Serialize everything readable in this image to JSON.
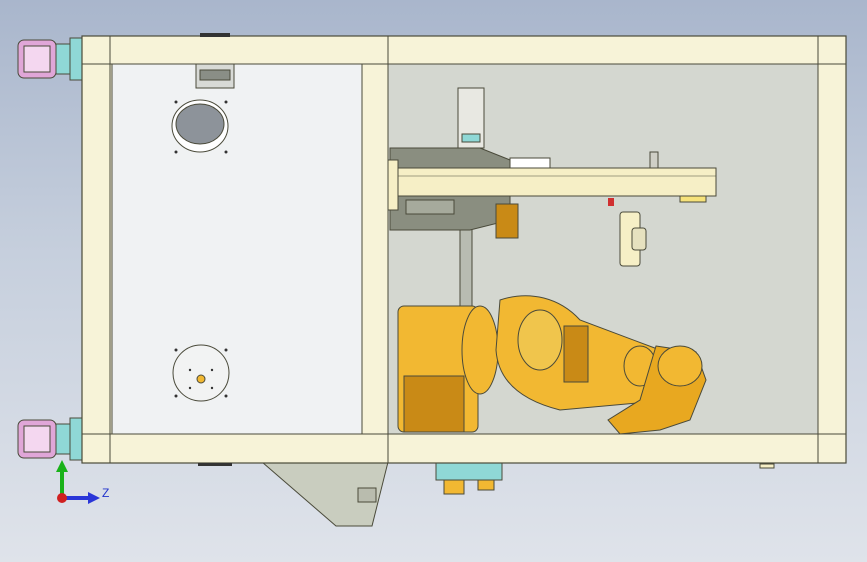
{
  "viewport": {
    "axis_triad": {
      "z_label": "Z"
    }
  },
  "colors": {
    "frame": "#f7f3d8",
    "frame_edge": "#4a4a3a",
    "panel": "#f0f2f3",
    "interior": "#d4d7d0",
    "robot": "#f2b832",
    "robot_dark": "#c98a16",
    "caster_pink": "#e0a6d8",
    "caster_cyan": "#8fd8d6",
    "steel": "#7f8378",
    "plate": "#f6efc6",
    "axis_y": "#19b219",
    "axis_z": "#2a36d8",
    "axis_origin": "#d02020"
  },
  "icons": [
    "axis-triad-icon"
  ]
}
